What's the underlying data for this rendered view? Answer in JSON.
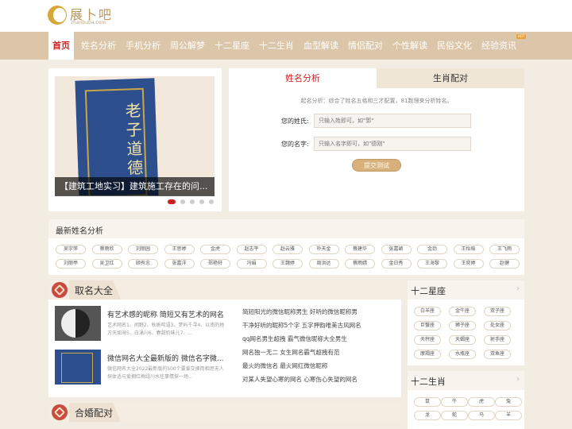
{
  "header": {
    "logo_title": "展卜吧",
    "logo_sub": "zhanbuba.com",
    "hot_badge": "HOT"
  },
  "nav": [
    "首页",
    "姓名分析",
    "手机分析",
    "周公解梦",
    "十二星座",
    "十二生肖",
    "血型解读",
    "情侣配对",
    "个性解读",
    "民俗文化",
    "经验资讯"
  ],
  "slider": {
    "caption": "【建筑工地实习】建筑施工存在的问...",
    "book_text": "老子道德"
  },
  "form": {
    "tab1": "姓名分析",
    "tab2": "生肖配对",
    "desc": "起名分析：综合了姓名五格和三才配置，81数理来分析姓名。",
    "surname_label": "您的姓氏:",
    "surname_ph": "只输入姓即可，如\"郭\"",
    "name_label": "您的名字:",
    "name_ph": "只输入名字即可，如\"德刚\"",
    "submit": "提交测试"
  },
  "latest": {
    "title": "最新姓名分析",
    "row1": [
      "吴宇萍",
      "蔡雨欣",
      "刘丽园",
      "王思婷",
      "金虎",
      "赵志平",
      "赵云雅",
      "朴天金",
      "蔡建华",
      "张嘉颖",
      "金劲",
      "王怡晗",
      "王飞雨"
    ],
    "row2": [
      "刘丽亭",
      "吴卫红",
      "顾有忠",
      "张嘉洋",
      "郑艳轩",
      "冯娟",
      "王魏婷",
      "周洪达",
      "蔡雨婧",
      "金日秀",
      "王海黎",
      "王奕婷",
      "赵健"
    ]
  },
  "qiming": {
    "title": "取名大全",
    "articles": [
      {
        "title": "有艺术感的昵称 简短又有艺术的网名",
        "desc": "艺术网名1、闹野2、秋栀咤语3、梦屿千寻4、以南的地方天如海5、白涌川6、春甜奶味儿7、..."
      },
      {
        "title": "微信网名大全最新版的 微信名字微...",
        "desc": "微信网名大全2022最新版的500个要爱交换而相思无人探体适与爱拥红梅绿川水往事情探一场..."
      }
    ],
    "links": [
      "简短阳光的微信昵称男生 好听的微信昵称男",
      "干净好听的昵称5个字 五字押韵唯美古风网名",
      "qq网名男生超拽 霸气微信昵称大全男生",
      "网名独一无二 女生网名霸气超拽有范",
      "最火的微信名 最火网红微信昵称",
      "对某人失望心寒的网名 心寒伤心失望的网名"
    ]
  },
  "hehun": {
    "title": "合婚配对"
  },
  "xingzuo": {
    "title": "十二星座",
    "items": [
      "白羊座",
      "金牛座",
      "双子座",
      "巨蟹座",
      "狮子座",
      "处女座",
      "天秤座",
      "天蝎座",
      "射手座",
      "摩羯座",
      "水瓶座",
      "双鱼座"
    ]
  },
  "shengxiao": {
    "title": "十二生肖",
    "items": [
      "鼠",
      "牛",
      "虎",
      "兔",
      "龙",
      "蛇",
      "马",
      "羊"
    ]
  },
  "chevron": "›"
}
